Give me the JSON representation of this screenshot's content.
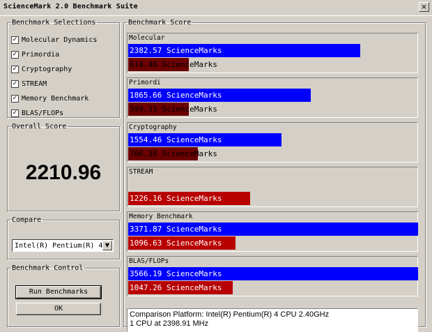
{
  "window": {
    "title": "ScienceMark 2.0 Benchmark Suite",
    "close_glyph": "×"
  },
  "selections": {
    "legend": "Benchmark Selections",
    "items": [
      {
        "label": "Molecular Dynamics",
        "checked": "✓"
      },
      {
        "label": "Primordia",
        "checked": "✓"
      },
      {
        "label": "Cryptography",
        "checked": "✓"
      },
      {
        "label": "STREAM",
        "checked": "✓"
      },
      {
        "label": "Memory Benchmark",
        "checked": "✓"
      },
      {
        "label": "BLAS/FLOPs",
        "checked": "✓"
      }
    ]
  },
  "overall": {
    "legend": "Overall Score",
    "value": "2210.96"
  },
  "compare": {
    "legend": "Compare",
    "selected": "Intel(R) Pentium(R) 4 CPU 2.40GHz",
    "arrow": "▼"
  },
  "control": {
    "legend": "Benchmark Control",
    "run_label": "Run Benchmarks",
    "ok_label": "OK"
  },
  "score": {
    "legend": "Benchmark Score",
    "benchmarks": [
      {
        "name": "Molecular",
        "current": "2382.57 ScienceMarks",
        "comparison": "614.46 ScienceMarks",
        "current_fraction": 0.8,
        "comparison_fraction": 0.21
      },
      {
        "name": "Primordi",
        "current": "1865.66 ScienceMarks",
        "comparison": "599.33 ScienceMarks",
        "current_fraction": 0.63,
        "comparison_fraction": 0.21
      },
      {
        "name": "Cryptography",
        "current": "1554.46 ScienceMarks",
        "comparison": "706.38 ScienceMarks",
        "current_fraction": 0.53,
        "comparison_fraction": 0.24
      },
      {
        "name": "STREAM",
        "current": "",
        "comparison": "1226.16 ScienceMarks",
        "current_fraction": 0,
        "comparison_fraction": 0.42
      },
      {
        "name": "Memory Benchmark",
        "current": "3371.87 ScienceMarks",
        "comparison": "1096.63 ScienceMarks",
        "current_fraction": 1.0,
        "comparison_fraction": 0.37
      },
      {
        "name": "BLAS/FLOPs",
        "current": "3566.19 ScienceMarks",
        "comparison": "1047.26 ScienceMarks",
        "current_fraction": 1.0,
        "comparison_fraction": 0.36
      }
    ],
    "platform_line": "Comparison Platform: Intel(R) Pentium(R) 4 CPU 2.40GHz",
    "cpu_line": "1 CPU at 2398.91 MHz"
  },
  "colors": {
    "current_bar": "#0000ff",
    "comparison_bar": "#b80000",
    "background": "#d4d0c8"
  }
}
